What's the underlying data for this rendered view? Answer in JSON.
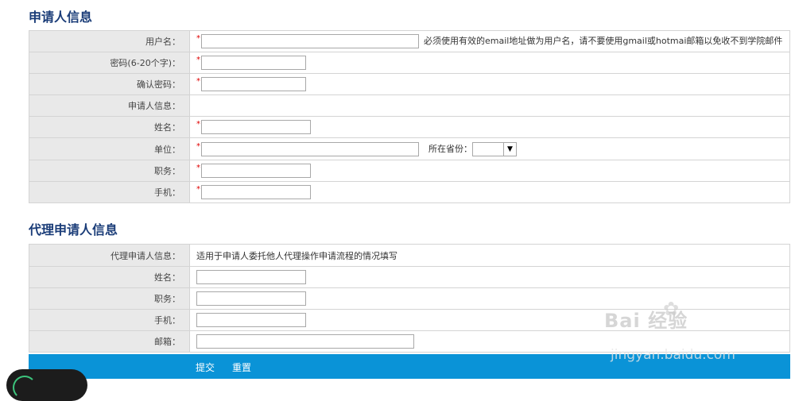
{
  "applicant": {
    "title": "申请人信息",
    "rows": {
      "username": {
        "label": "用户名：",
        "hint": "必须使用有效的email地址做为用户名，请不要使用gmail或hotmai邮箱以免收不到学院邮件"
      },
      "password": {
        "label": "密码(6-20个字)："
      },
      "confirm": {
        "label": "确认密码："
      },
      "info": {
        "label": "申请人信息："
      },
      "name": {
        "label": "姓名："
      },
      "unit": {
        "label": "单位：",
        "province_label": "所在省份："
      },
      "position": {
        "label": "职务："
      },
      "mobile": {
        "label": "手机："
      }
    },
    "required_mark": "*"
  },
  "proxy": {
    "title": "代理申请人信息",
    "rows": {
      "info": {
        "label": "代理申请人信息：",
        "note": "适用于申请人委托他人代理操作申请流程的情况填写"
      },
      "name": {
        "label": "姓名："
      },
      "position": {
        "label": "职务："
      },
      "mobile": {
        "label": "手机："
      },
      "email": {
        "label": "邮箱："
      }
    }
  },
  "actions": {
    "submit": "提交",
    "reset": "重置"
  },
  "watermark": {
    "line1": "Bai 经验",
    "line2": "jingyan.baidu.com"
  },
  "colors": {
    "title": "#1a3c78",
    "submit_bar": "#0a93d7",
    "label_bg": "#e9e9e9",
    "required": "#e00000"
  }
}
